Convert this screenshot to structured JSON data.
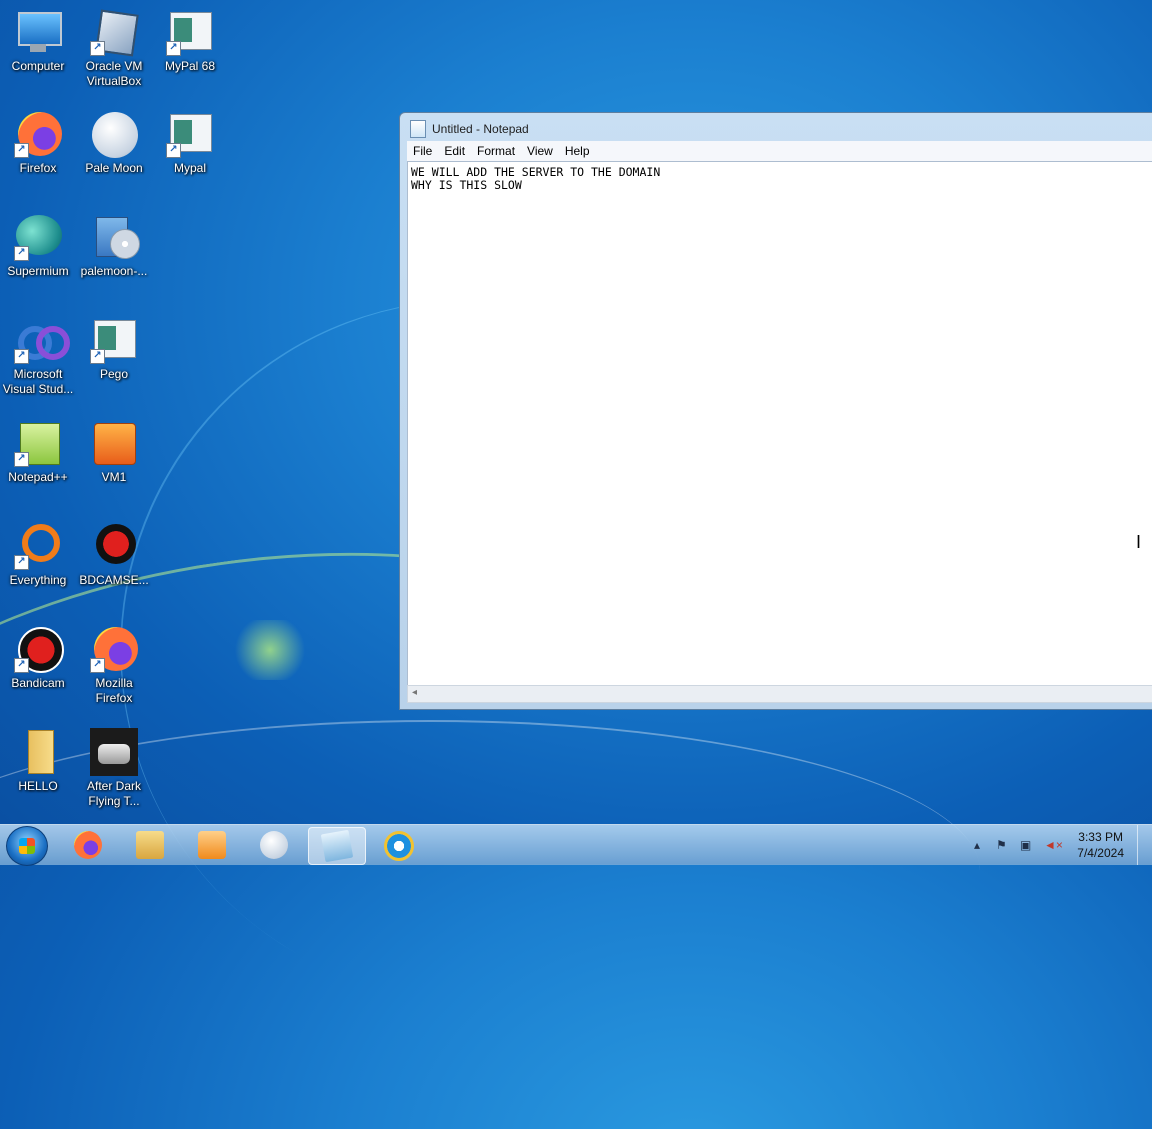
{
  "desktop": {
    "icons": [
      {
        "label": "Computer",
        "icon": "computer-icon"
      },
      {
        "label": "Oracle VM VirtualBox",
        "icon": "virtualbox-icon"
      },
      {
        "label": "MyPal 68",
        "icon": "mypal-icon"
      },
      {
        "label": "Firefox",
        "icon": "firefox-icon"
      },
      {
        "label": "Pale Moon",
        "icon": "palemoon-icon"
      },
      {
        "label": "Mypal",
        "icon": "mypal-icon"
      },
      {
        "label": "Supermium",
        "icon": "supermium-icon"
      },
      {
        "label": "palemoon-...",
        "icon": "installer-icon"
      },
      {
        "label": "Microsoft Visual Stud...",
        "icon": "visual-studio-icon"
      },
      {
        "label": "Pego",
        "icon": "window-app-icon"
      },
      {
        "label": "Notepad++",
        "icon": "notepadpp-icon"
      },
      {
        "label": "VM1",
        "icon": "vm-icon"
      },
      {
        "label": "Everything",
        "icon": "everything-icon"
      },
      {
        "label": "BDCAMSE...",
        "icon": "bandicam-setup-icon"
      },
      {
        "label": "Bandicam",
        "icon": "bandicam-icon"
      },
      {
        "label": "Mozilla Firefox",
        "icon": "firefox-icon"
      },
      {
        "label": "HELLO",
        "icon": "folder-icon"
      },
      {
        "label": "After Dark Flying T...",
        "icon": "toaster-icon"
      }
    ]
  },
  "notepad": {
    "title": "Untitled - Notepad",
    "menu": [
      "File",
      "Edit",
      "Format",
      "View",
      "Help"
    ],
    "lines": [
      "WE WILL ADD THE SERVER TO THE DOMAIN",
      "WHY IS THIS SLOW"
    ]
  },
  "taskbar": {
    "apps": [
      "firefox-icon",
      "explorer-icon",
      "media-player-icon",
      "palemoon-icon",
      "notepad-icon",
      "internet-explorer-icon"
    ],
    "clock": {
      "time": "3:33 PM",
      "date": "7/4/2024"
    }
  }
}
